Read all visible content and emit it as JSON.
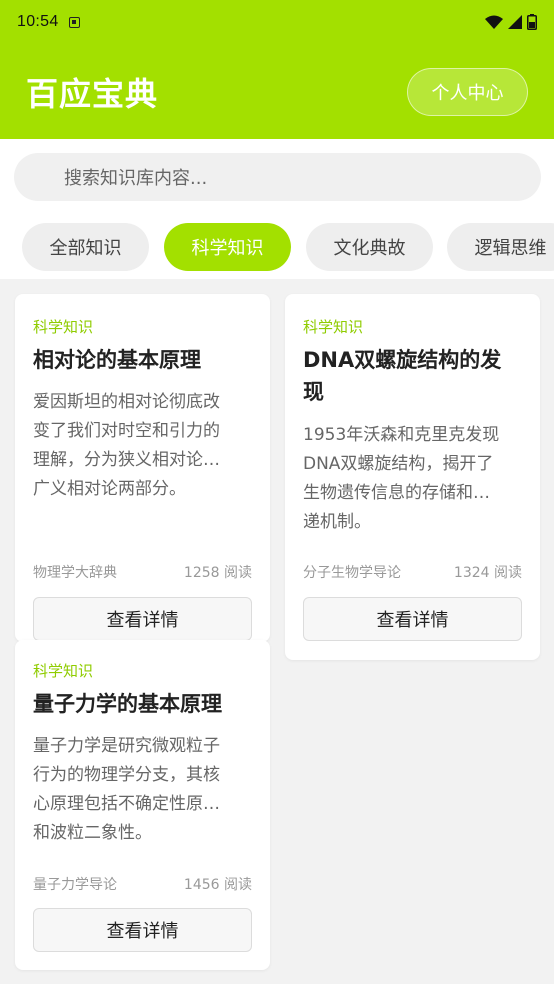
{
  "status_bar": {
    "time": "10:54"
  },
  "header": {
    "title": "百应宝典",
    "profile_button": "个人中心"
  },
  "search": {
    "placeholder": "搜索知识库内容..."
  },
  "tabs": [
    {
      "label": "全部知识",
      "active": false
    },
    {
      "label": "科学知识",
      "active": true
    },
    {
      "label": "文化典故",
      "active": false
    },
    {
      "label": "逻辑思维",
      "active": false
    }
  ],
  "cards": [
    {
      "category": "科学知识",
      "title": "相对论的基本原理",
      "description_lines": [
        "爱因斯坦的相对论彻底改",
        "变了我们对时空和引力的",
        "理解，分为狭义相对论…",
        "广义相对论两部分。"
      ],
      "source": "物理学大辞典",
      "reads": "1258 阅读",
      "button": "查看详情"
    },
    {
      "category": "科学知识",
      "title_lines": [
        "DNA双螺旋结构的发",
        "现"
      ],
      "description_lines": [
        "1953年沃森和克里克发现",
        "DNA双螺旋结构，揭开了",
        "生物遗传信息的存储和…",
        "递机制。"
      ],
      "source": "分子生物学导论",
      "reads": "1324 阅读",
      "button": "查看详情"
    },
    {
      "category": "科学知识",
      "title": "量子力学的基本原理",
      "description_lines": [
        "量子力学是研究微观粒子",
        "行为的物理学分支，其核",
        "心原理包括不确定性原…",
        "和波粒二象性。"
      ],
      "source": "量子力学导论",
      "reads": "1456 阅读",
      "button": "查看详情"
    }
  ],
  "colors": {
    "accent": "#a3e000",
    "category": "#8fcc00"
  },
  "icons": [
    "app-notification-icon",
    "wifi-icon",
    "signal-icon",
    "battery-icon",
    "search-icon"
  ]
}
